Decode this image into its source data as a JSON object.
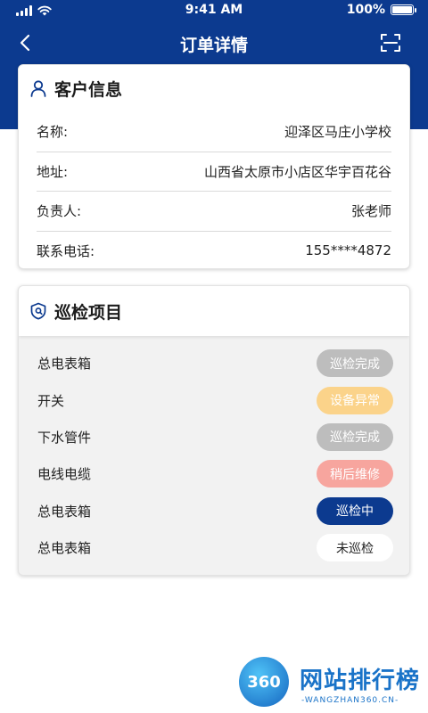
{
  "status_bar": {
    "time": "9:41 AM",
    "battery": "100%",
    "battery_level": 1.0
  },
  "nav": {
    "title": "订单详情",
    "back_icon": "chevron-left-icon",
    "scan_icon": "scan-icon"
  },
  "customer": {
    "title": "客户信息",
    "icon": "user-icon",
    "rows": [
      {
        "label": "名称:",
        "value": "迎泽区马庄小学校"
      },
      {
        "label": "地址:",
        "value": "山西省太原市小店区华宇百花谷"
      },
      {
        "label": "负责人:",
        "value": "张老师"
      },
      {
        "label": "联系电话:",
        "value": "155****4872"
      }
    ]
  },
  "patrol": {
    "title": "巡检项目",
    "icon": "shield-icon",
    "items": [
      {
        "name": "总电表箱",
        "status": "巡检完成",
        "bg": "#bdbdbd",
        "fg": "#ffffff"
      },
      {
        "name": "开关",
        "status": "设备异常",
        "bg": "#fbd38a",
        "fg": "#ffffff"
      },
      {
        "name": "下水管件",
        "status": "巡检完成",
        "bg": "#bdbdbd",
        "fg": "#ffffff"
      },
      {
        "name": "电线电缆",
        "status": "稍后维修",
        "bg": "#f7a59e",
        "fg": "#ffffff"
      },
      {
        "name": "总电表箱",
        "status": "巡检中",
        "bg": "#0c3a8f",
        "fg": "#ffffff"
      },
      {
        "name": "总电表箱",
        "status": "未巡检",
        "bg": "#ffffff",
        "fg": "#222222"
      }
    ]
  },
  "watermark": {
    "badge": "360",
    "title": "网站排行榜",
    "subtitle": "-WANGZHAN360.CN-"
  },
  "colors": {
    "brand": "#0c3a8f"
  }
}
